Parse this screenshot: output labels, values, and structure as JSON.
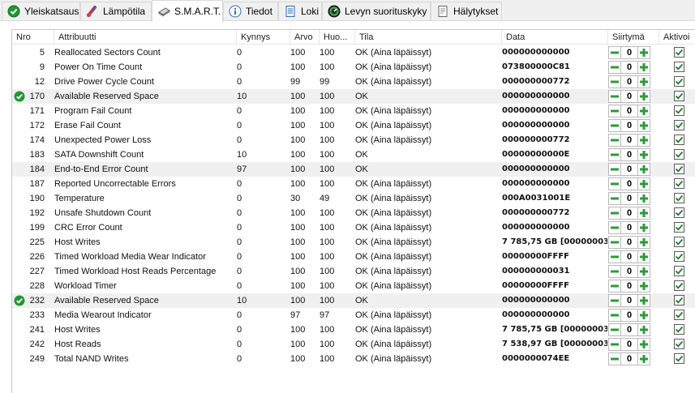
{
  "tabs": [
    {
      "label": "Yleiskatsaus",
      "icon": "check-circle-icon",
      "active": false
    },
    {
      "label": "Lämpötila",
      "icon": "thermometer-icon",
      "active": false
    },
    {
      "label": "S.M.A.R.T.",
      "icon": "smart-drive-icon",
      "active": true
    },
    {
      "label": "Tiedot",
      "icon": "info-icon",
      "active": false
    },
    {
      "label": "Loki",
      "icon": "log-document-icon",
      "active": false
    },
    {
      "label": "Levyn suorituskyky",
      "icon": "performance-gauge-icon",
      "active": false
    },
    {
      "label": "Hälytykset",
      "icon": "alerts-document-icon",
      "active": false
    }
  ],
  "columns": {
    "nro": "Nro",
    "attribute": "Attribuutti",
    "threshold": "Kynnys",
    "value": "Arvo",
    "worst": "Huo...",
    "status": "Tila",
    "data": "Data",
    "offset": "Siirtymä",
    "active": "Aktivoi"
  },
  "colors": {
    "stepper_green": "#2e9a3c",
    "ok_icon_green": "#1e9a2f",
    "highlight_row": "#f0f0f0",
    "checkbox_tick": "#1f7a2e"
  },
  "rows": [
    {
      "nro": "5",
      "attribute": "Reallocated Sectors Count",
      "threshold": "0",
      "value": "100",
      "worst": "100",
      "status": "OK (Aina läpäissyt)",
      "data": "000000000000",
      "offset": "0",
      "checked": true,
      "highlight": false,
      "ok_icon": false
    },
    {
      "nro": "9",
      "attribute": "Power On Time Count",
      "threshold": "0",
      "value": "100",
      "worst": "100",
      "status": "OK (Aina läpäissyt)",
      "data": "073800000C81",
      "offset": "0",
      "checked": true,
      "highlight": false,
      "ok_icon": false
    },
    {
      "nro": "12",
      "attribute": "Drive Power Cycle Count",
      "threshold": "0",
      "value": "99",
      "worst": "99",
      "status": "OK (Aina läpäissyt)",
      "data": "000000000772",
      "offset": "0",
      "checked": true,
      "highlight": false,
      "ok_icon": false
    },
    {
      "nro": "170",
      "attribute": "Available Reserved Space",
      "threshold": "10",
      "value": "100",
      "worst": "100",
      "status": "OK",
      "data": "000000000000",
      "offset": "0",
      "checked": true,
      "highlight": true,
      "ok_icon": true
    },
    {
      "nro": "171",
      "attribute": "Program Fail Count",
      "threshold": "0",
      "value": "100",
      "worst": "100",
      "status": "OK (Aina läpäissyt)",
      "data": "000000000000",
      "offset": "0",
      "checked": true,
      "highlight": false,
      "ok_icon": false
    },
    {
      "nro": "172",
      "attribute": "Erase Fail Count",
      "threshold": "0",
      "value": "100",
      "worst": "100",
      "status": "OK (Aina läpäissyt)",
      "data": "000000000000",
      "offset": "0",
      "checked": true,
      "highlight": false,
      "ok_icon": false
    },
    {
      "nro": "174",
      "attribute": "Unexpected Power Loss",
      "threshold": "0",
      "value": "100",
      "worst": "100",
      "status": "OK (Aina läpäissyt)",
      "data": "000000000772",
      "offset": "0",
      "checked": true,
      "highlight": false,
      "ok_icon": false
    },
    {
      "nro": "183",
      "attribute": "SATA Downshift Count",
      "threshold": "10",
      "value": "100",
      "worst": "100",
      "status": "OK",
      "data": "00000000000E",
      "offset": "0",
      "checked": true,
      "highlight": false,
      "ok_icon": false
    },
    {
      "nro": "184",
      "attribute": "End-to-End Error Count",
      "threshold": "97",
      "value": "100",
      "worst": "100",
      "status": "OK",
      "data": "000000000000",
      "offset": "0",
      "checked": true,
      "highlight": true,
      "ok_icon": false
    },
    {
      "nro": "187",
      "attribute": "Reported Uncorrectable Errors",
      "threshold": "0",
      "value": "100",
      "worst": "100",
      "status": "OK (Aina läpäissyt)",
      "data": "000000000000",
      "offset": "0",
      "checked": true,
      "highlight": false,
      "ok_icon": false
    },
    {
      "nro": "190",
      "attribute": "Temperature",
      "threshold": "0",
      "value": "30",
      "worst": "49",
      "status": "OK (Aina läpäissyt)",
      "data": "000A0031001E",
      "offset": "0",
      "checked": true,
      "highlight": false,
      "ok_icon": false
    },
    {
      "nro": "192",
      "attribute": "Unsafe Shutdown Count",
      "threshold": "0",
      "value": "100",
      "worst": "100",
      "status": "OK (Aina läpäissyt)",
      "data": "000000000772",
      "offset": "0",
      "checked": true,
      "highlight": false,
      "ok_icon": false
    },
    {
      "nro": "199",
      "attribute": "CRC Error Count",
      "threshold": "0",
      "value": "100",
      "worst": "100",
      "status": "OK (Aina läpäissyt)",
      "data": "000000000000",
      "offset": "0",
      "checked": true,
      "highlight": false,
      "ok_icon": false
    },
    {
      "nro": "225",
      "attribute": "Host Writes",
      "threshold": "0",
      "value": "100",
      "worst": "100",
      "status": "OK (Aina läpäissyt)",
      "data": "7 785,75 GB [00000003...",
      "offset": "0",
      "checked": true,
      "highlight": false,
      "ok_icon": false
    },
    {
      "nro": "226",
      "attribute": "Timed Workload Media Wear Indicator",
      "threshold": "0",
      "value": "100",
      "worst": "100",
      "status": "OK (Aina läpäissyt)",
      "data": "00000000FFFF",
      "offset": "0",
      "checked": true,
      "highlight": false,
      "ok_icon": false
    },
    {
      "nro": "227",
      "attribute": "Timed Workload Host Reads Percentage",
      "threshold": "0",
      "value": "100",
      "worst": "100",
      "status": "OK (Aina läpäissyt)",
      "data": "000000000031",
      "offset": "0",
      "checked": true,
      "highlight": false,
      "ok_icon": false
    },
    {
      "nro": "228",
      "attribute": "Workload Timer",
      "threshold": "0",
      "value": "100",
      "worst": "100",
      "status": "OK (Aina läpäissyt)",
      "data": "00000000FFFF",
      "offset": "0",
      "checked": true,
      "highlight": false,
      "ok_icon": false
    },
    {
      "nro": "232",
      "attribute": "Available Reserved Space",
      "threshold": "10",
      "value": "100",
      "worst": "100",
      "status": "OK",
      "data": "000000000000",
      "offset": "0",
      "checked": true,
      "highlight": true,
      "ok_icon": true
    },
    {
      "nro": "233",
      "attribute": "Media Wearout Indicator",
      "threshold": "0",
      "value": "97",
      "worst": "97",
      "status": "OK (Aina läpäissyt)",
      "data": "000000000000",
      "offset": "0",
      "checked": true,
      "highlight": false,
      "ok_icon": false
    },
    {
      "nro": "241",
      "attribute": "Host Writes",
      "threshold": "0",
      "value": "100",
      "worst": "100",
      "status": "OK (Aina läpäissyt)",
      "data": "7 785,75 GB [00000003...",
      "offset": "0",
      "checked": true,
      "highlight": false,
      "ok_icon": false
    },
    {
      "nro": "242",
      "attribute": "Host Reads",
      "threshold": "0",
      "value": "100",
      "worst": "100",
      "status": "OK (Aina läpäissyt)",
      "data": "7 538,97 GB [00000003...",
      "offset": "0",
      "checked": true,
      "highlight": false,
      "ok_icon": false
    },
    {
      "nro": "249",
      "attribute": "Total NAND Writes",
      "threshold": "0",
      "value": "100",
      "worst": "100",
      "status": "OK (Aina läpäissyt)",
      "data": "0000000074EE",
      "offset": "0",
      "checked": true,
      "highlight": false,
      "ok_icon": false
    }
  ]
}
